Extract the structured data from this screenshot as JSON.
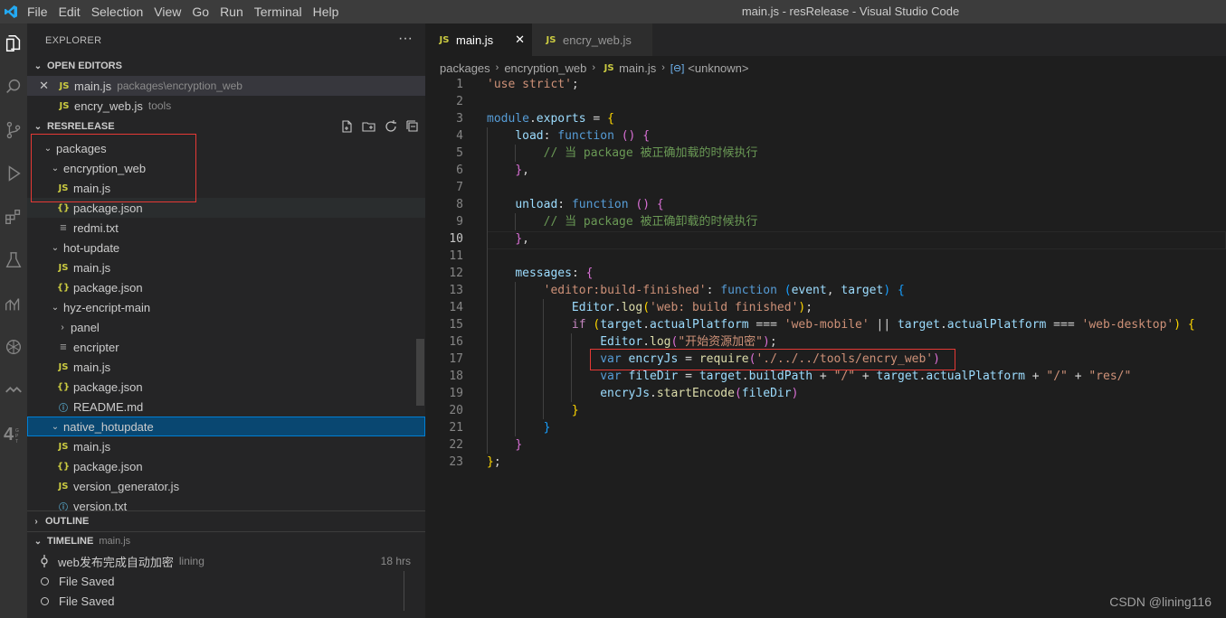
{
  "menu": [
    "File",
    "Edit",
    "Selection",
    "View",
    "Go",
    "Run",
    "Terminal",
    "Help"
  ],
  "window_title": "main.js - resRelease - Visual Studio Code",
  "explorer": {
    "header": "EXPLORER",
    "more": "···",
    "open_editors": {
      "label": "OPEN EDITORS",
      "items": [
        {
          "name": "main.js",
          "desc": "packages\\encryption_web"
        },
        {
          "name": "encry_web.js",
          "desc": "tools"
        }
      ]
    },
    "workspace": {
      "label": "RESRELEASE",
      "tree": [
        {
          "label": "packages"
        },
        {
          "label": "encryption_web"
        },
        {
          "label": "main.js"
        },
        {
          "label": "package.json"
        },
        {
          "label": "redmi.txt"
        },
        {
          "label": "hot-update"
        },
        {
          "label": "main.js"
        },
        {
          "label": "package.json"
        },
        {
          "label": "hyz-encript-main"
        },
        {
          "label": "panel"
        },
        {
          "label": "encripter"
        },
        {
          "label": "main.js"
        },
        {
          "label": "package.json"
        },
        {
          "label": "README.md"
        },
        {
          "label": "native_hotupdate"
        },
        {
          "label": "main.js"
        },
        {
          "label": "package.json"
        },
        {
          "label": "version_generator.js"
        },
        {
          "label": "version.txt"
        }
      ]
    },
    "outline_label": "OUTLINE",
    "timeline": {
      "label": "TIMELINE",
      "file": "main.js",
      "items": [
        {
          "label": "web发布完成自动加密",
          "author": "lining",
          "time": "18 hrs"
        },
        {
          "label": "File Saved"
        },
        {
          "label": "File Saved"
        }
      ]
    }
  },
  "tabs": [
    {
      "label": "main.js",
      "icon": "JS",
      "close": "✕"
    },
    {
      "label": "encry_web.js",
      "icon": "JS"
    }
  ],
  "breadcrumb": [
    "packages",
    "encryption_web",
    "main.js",
    "<unknown>"
  ],
  "line_numbers": [
    "1",
    "2",
    "3",
    "4",
    "5",
    "6",
    "7",
    "8",
    "9",
    "10",
    "11",
    "12",
    "13",
    "14",
    "15",
    "16",
    "17",
    "18",
    "19",
    "20",
    "21",
    "22",
    "23"
  ],
  "current_line": 10,
  "watermark": "CSDN @lining116",
  "colors": {
    "accent": "#007acc",
    "selection": "#094771",
    "highlight_box": "#e53935"
  }
}
